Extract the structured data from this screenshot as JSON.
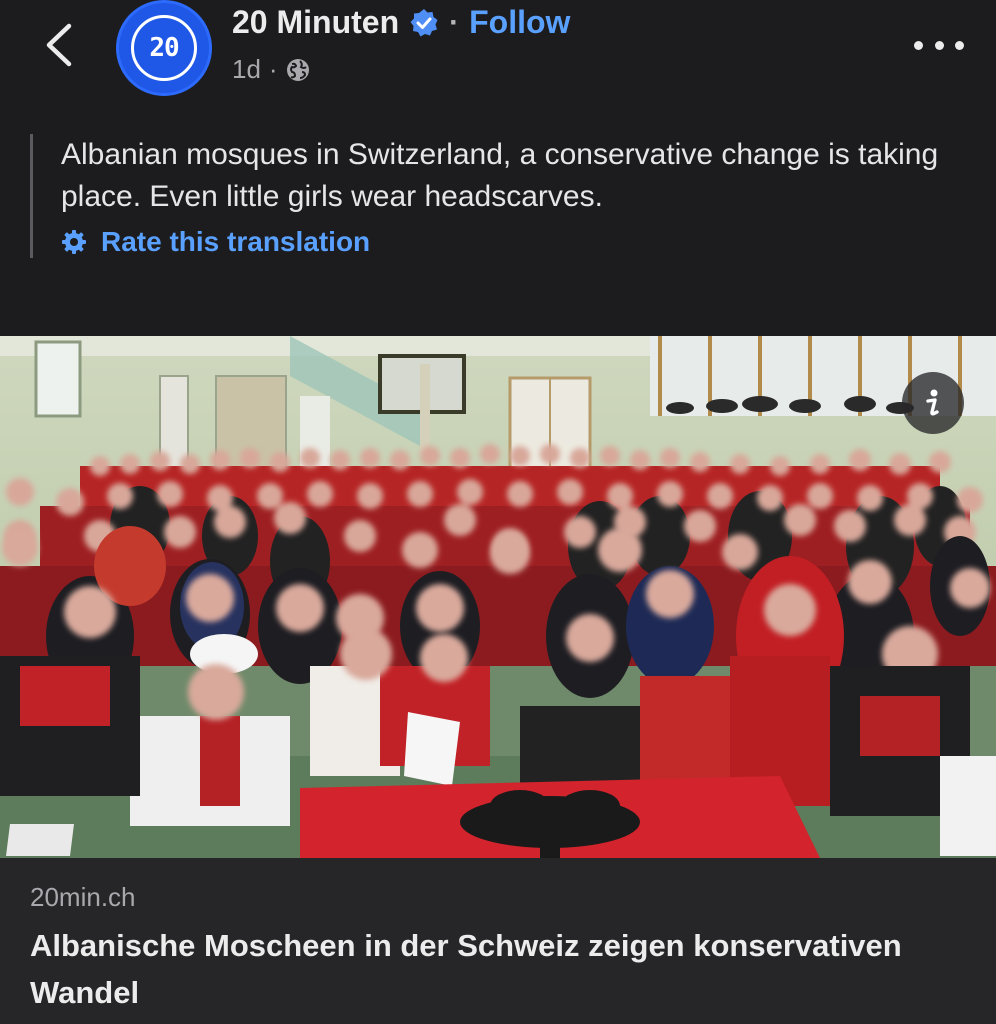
{
  "post": {
    "page_name": "20 Minuten",
    "separator": "·",
    "follow_label": "Follow",
    "time_ago": "1d",
    "meta_separator": "·",
    "avatar_text": "20",
    "caption": "Albanian mosques in Switzerland, a conservative change is taking place. Even little girls wear headscarves.",
    "rate_translation_label": "Rate this translation"
  },
  "link_preview": {
    "domain": "20min.ch",
    "title": "Albanische Moscheen in der Schweiz zeigen konservativen Wandel"
  },
  "icons": {
    "back": "chevron-left-icon",
    "verified": "verified-badge-icon",
    "globe": "globe-icon",
    "more": "more-horizontal-icon",
    "gear": "gear-icon",
    "info": "info-icon"
  },
  "colors": {
    "background": "#1c1c1e",
    "accent": "#5aa1ff",
    "brand_blue": "#1f57e6",
    "card_background": "#262629"
  }
}
